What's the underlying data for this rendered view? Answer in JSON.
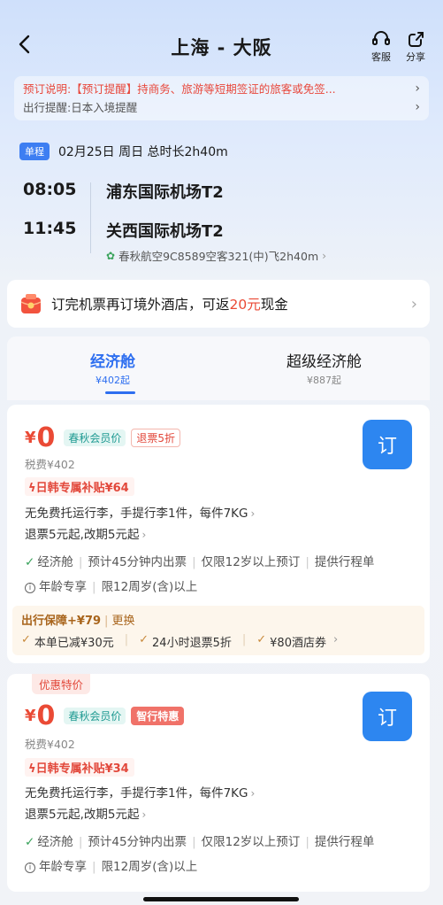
{
  "header": {
    "title": "上海 - 大阪",
    "service_label": "客服",
    "share_label": "分享"
  },
  "notice": {
    "booking_label": "预订说明:",
    "booking_text": "【预订提醒】持商务、旅游等短期签证的旅客或免签...",
    "travel_label": "出行提醒:",
    "travel_text": "日本入境提醒"
  },
  "trip": {
    "type_badge": "单程",
    "date_info": "02月25日 周日 总时长2h40m",
    "depart_time": "08:05",
    "depart_airport": "浦东国际机场T2",
    "arrive_time": "11:45",
    "arrive_airport": "关西国际机场T2",
    "flight_meta": "春秋航空9C8589空客321(中)飞2h40m"
  },
  "promo": {
    "text_before": "订完机票再订境外酒店，可返",
    "amount": "20元",
    "text_after": "现金"
  },
  "tabs": [
    {
      "name": "经济舱",
      "price": "¥402起",
      "active": true
    },
    {
      "name": "超级经济舱",
      "price": "¥887起",
      "active": false
    }
  ],
  "fares": [
    {
      "top_tag": "",
      "yen": "¥",
      "amount": "0",
      "tag1": "春秋会员价",
      "tag2": "退票5折",
      "book_label": "订",
      "tax": "税费¥402",
      "subsidy": "日韩专属补贴¥64",
      "baggage": "无免费托运行李，手提行李1件，每件7KG",
      "change": "退票5元起,改期5元起",
      "cabin": "经济舱",
      "issue": "预计45分钟内出票",
      "age_only": "仅限12岁以上预订",
      "itinerary": "提供行程单",
      "age_special": "年龄专享",
      "age_limit": "限12周岁(含)以上",
      "guarantee": {
        "title": "出行保障",
        "price": "+¥79",
        "change_label": "更换",
        "items": [
          "本单已减¥30元",
          "24小时退票5折",
          "¥80酒店券"
        ]
      }
    },
    {
      "top_tag": "优惠特价",
      "yen": "¥",
      "amount": "0",
      "tag1": "春秋会员价",
      "tag2": "智行特惠",
      "book_label": "订",
      "tax": "税费¥402",
      "subsidy": "日韩专属补贴¥34",
      "baggage": "无免费托运行李，手提行李1件，每件7KG",
      "change": "退票5元起,改期5元起",
      "cabin": "经济舱",
      "issue": "预计45分钟内出票",
      "age_only": "仅限12岁以上预订",
      "itinerary": "提供行程单",
      "age_special": "年龄专享",
      "age_limit": "限12周岁(含)以上"
    }
  ],
  "colors": {
    "accent_blue": "#2e6ff0",
    "price_red": "#ea4a35",
    "teal": "#1f9a92",
    "gold": "#a8641b"
  }
}
